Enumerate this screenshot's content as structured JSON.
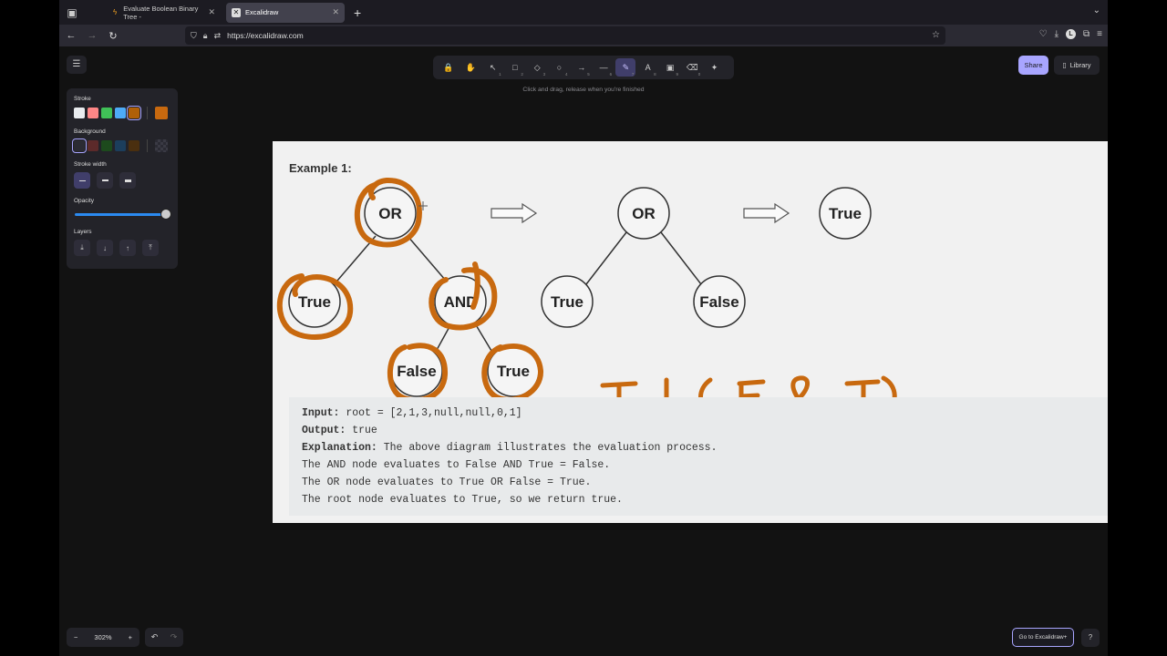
{
  "browser": {
    "tabs": [
      {
        "title": "Evaluate Boolean Binary Tree -",
        "active": false
      },
      {
        "title": "Excalidraw",
        "active": true
      }
    ],
    "url": "https://excalidraw.com"
  },
  "excalidraw": {
    "toolbar": [
      {
        "name": "lock",
        "icon": "🔒",
        "key": ""
      },
      {
        "name": "hand",
        "icon": "✋",
        "key": ""
      },
      {
        "name": "selection",
        "icon": "↖",
        "key": "1"
      },
      {
        "name": "rectangle",
        "icon": "□",
        "key": "2"
      },
      {
        "name": "diamond",
        "icon": "◇",
        "key": "3"
      },
      {
        "name": "ellipse",
        "icon": "○",
        "key": "4"
      },
      {
        "name": "arrow",
        "icon": "→",
        "key": "5"
      },
      {
        "name": "line",
        "icon": "—",
        "key": "6"
      },
      {
        "name": "draw",
        "icon": "✎",
        "key": "7"
      },
      {
        "name": "text",
        "icon": "A",
        "key": "8"
      },
      {
        "name": "image",
        "icon": "▣",
        "key": "9"
      },
      {
        "name": "eraser",
        "icon": "⌫",
        "key": "0"
      },
      {
        "name": "more-tools",
        "icon": "✦",
        "key": ""
      }
    ],
    "active_tool": "draw",
    "hint": "Click and drag, release when you're finished",
    "share_label": "Share",
    "library_label": "Library",
    "properties": {
      "stroke_label": "Stroke",
      "stroke_colors": [
        "#e9ecef",
        "#ff8787",
        "#40c057",
        "#4dabf7",
        "#b06008"
      ],
      "stroke_current": "#c8690f",
      "background_label": "Background",
      "background_colors": [
        "#2b2b33",
        "#5c2a2a",
        "#1d4a1d",
        "#1c3e5c",
        "#4a2f0f"
      ],
      "stroke_width_label": "Stroke width",
      "opacity_label": "Opacity",
      "layers_label": "Layers"
    },
    "zoom": "302%",
    "go_plus_label": "Go to Excalidraw+"
  },
  "content": {
    "example_title": "Example 1:",
    "tree1": {
      "root": "OR",
      "left": "True",
      "right": "AND",
      "right_left": "False",
      "right_right": "True"
    },
    "tree2": {
      "root": "OR",
      "left": "True",
      "right": "False"
    },
    "tree3": {
      "root": "True"
    },
    "handwriting": "T | ( F & T)",
    "code_lines": [
      {
        "label": "Input:",
        "text": " root = [2,1,3,null,null,0,1]"
      },
      {
        "label": "Output:",
        "text": " true"
      },
      {
        "label": "Explanation:",
        "text": " The above diagram illustrates the evaluation process."
      },
      {
        "label": "",
        "text": "The AND node evaluates to False AND True = False."
      },
      {
        "label": "",
        "text": "The OR node evaluates to True OR False = True."
      },
      {
        "label": "",
        "text": "The root node evaluates to True, so we return true."
      }
    ]
  },
  "colors": {
    "accent": "#a8a5ff",
    "ink": "#c8690f"
  }
}
